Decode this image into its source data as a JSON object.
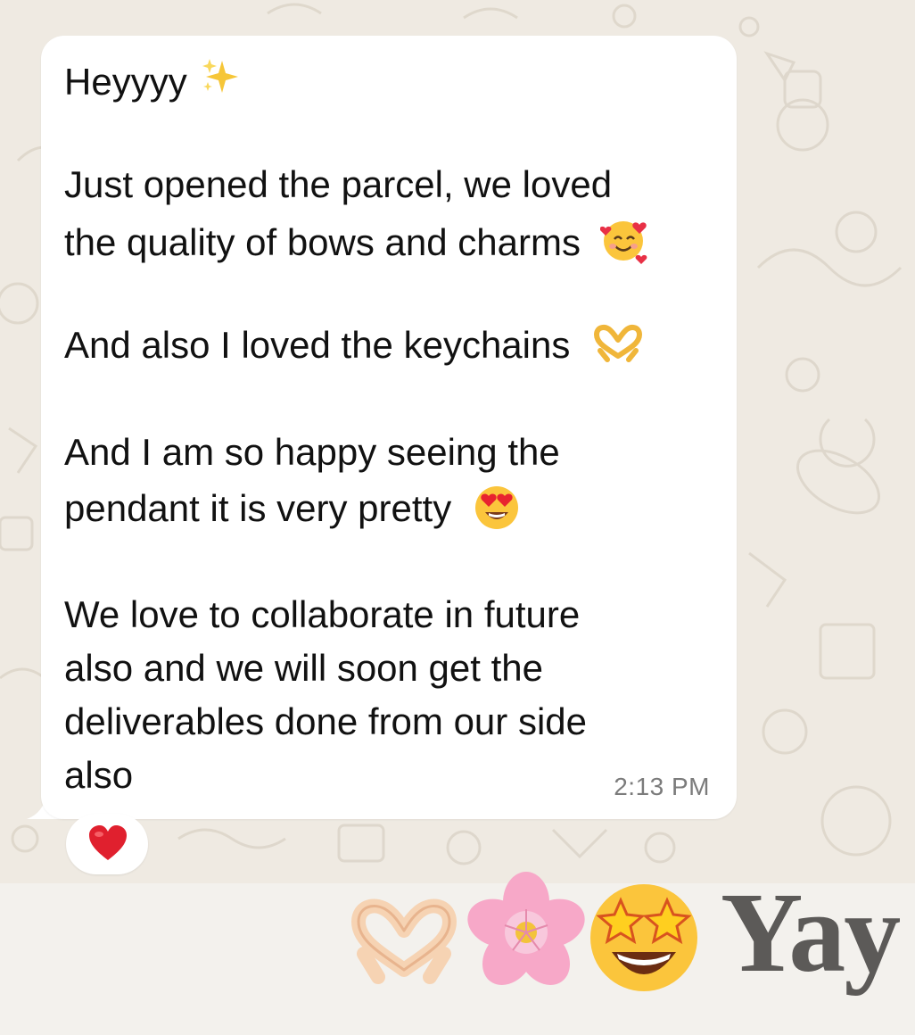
{
  "message": {
    "lines": [
      "Heyyyy",
      "Just opened the parcel, we loved",
      "the quality of bows and charms",
      "And also I loved the keychains",
      "And I am so happy seeing the",
      "pendant it is very pretty",
      "We love to collaborate in future",
      "also and we will soon get the",
      "deliverables done from our side",
      "also"
    ],
    "emoji_names": {
      "line0": "sparkles-icon",
      "line2": "smiling-face-with-hearts-icon",
      "line3": "heart-hands-icon",
      "line5": "heart-eyes-face-icon"
    },
    "time": "2:13 PM"
  },
  "reaction": {
    "emoji_name": "red-heart-icon",
    "color": "#e0202e"
  },
  "sticker": {
    "icons": [
      "heart-hands-icon",
      "cherry-blossom-icon",
      "star-struck-face-icon"
    ],
    "text": "Yay"
  },
  "colors": {
    "bubble": "#ffffff",
    "wallpaper": "#efeae2",
    "text": "#111111",
    "timestamp": "#7b7b7b",
    "yay": "#5c5a58"
  }
}
